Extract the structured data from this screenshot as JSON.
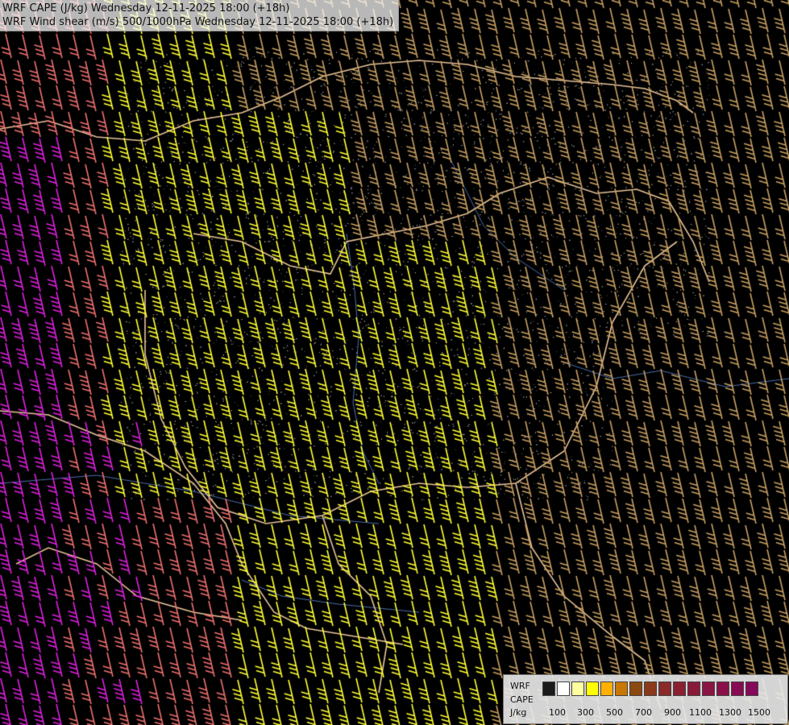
{
  "title": {
    "line1": "WRF CAPE (J/kg) Wednesday 12-11-2025 18:00 (+18h)",
    "line2": "WRF Wind shear (m/s) 500/1000hPa Wednesday 12-11-2025 18:00 (+18h)"
  },
  "legend": {
    "model": "WRF",
    "variable": "CAPE",
    "unit": "J/kg",
    "tick_labels": [
      "100",
      "300",
      "500",
      "700",
      "900",
      "1100",
      "1300",
      "1500"
    ],
    "colors": [
      "#1a1a1a",
      "#ffffff",
      "#ffffa0",
      "#ffff00",
      "#ffb000",
      "#c87800",
      "#8c4a10",
      "#8a3a1a",
      "#8a2a2a",
      "#8a2030",
      "#8a1a3a",
      "#8a1442",
      "#8a104a",
      "#880a52",
      "#86085a"
    ]
  },
  "map": {
    "background_color": "#000000",
    "border_color": "#e8c39a",
    "river_color": "#4a6fb0",
    "barb_colors": {
      "weak": "#ffff33",
      "moderate": "#c8a060",
      "strong": "#f07070",
      "very_strong": "#e020e0"
    }
  }
}
